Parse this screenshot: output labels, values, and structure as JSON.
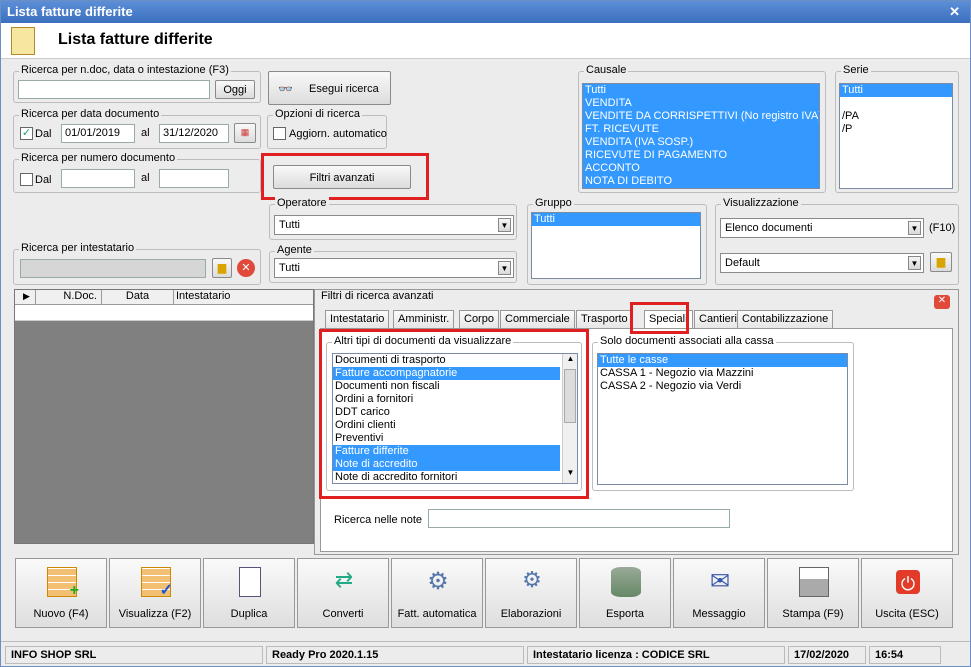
{
  "window": {
    "title": "Lista fatture differite",
    "close": "✕"
  },
  "header": {
    "title": "Lista fatture differite"
  },
  "search_ndoc": {
    "legend": "Ricerca per n.doc, data o intestazione (F3)",
    "value": "",
    "ok": "Oggi"
  },
  "execute": {
    "label": "Esegui ricerca"
  },
  "data_doc": {
    "legend": "Ricerca per data documento",
    "dal_label": "Dal",
    "dal_checked": "✓",
    "from": "01/01/2019",
    "al_label": "al",
    "to": "31/12/2020"
  },
  "opzioni": {
    "legend": "Opzioni di ricerca",
    "auto_label": "Aggiorn. automatico"
  },
  "num_doc": {
    "legend": "Ricerca per numero documento",
    "dal_label": "Dal",
    "al_label": "al"
  },
  "filtri_btn": {
    "label": "Filtri avanzati"
  },
  "operatore": {
    "legend": "Operatore",
    "value": "Tutti"
  },
  "agente": {
    "legend": "Agente",
    "value": "Tutti"
  },
  "intestatario": {
    "legend": "Ricerca per intestatario"
  },
  "causale": {
    "legend": "Causale",
    "items": [
      "Tutti",
      "VENDITA",
      "VENDITE DA CORRISPETTIVI (No registro IVA)",
      "FT. RICEVUTE",
      "VENDITA (IVA SOSP.)",
      "RICEVUTE DI PAGAMENTO",
      "ACCONTO",
      "NOTA DI DEBITO"
    ]
  },
  "serie": {
    "legend": "Serie",
    "items": [
      "Tutti",
      "",
      "/PA",
      "/P"
    ]
  },
  "gruppo": {
    "legend": "Gruppo",
    "items": [
      "Tutti"
    ]
  },
  "visualizzazione": {
    "legend": "Visualizzazione",
    "value1": "Elenco documenti",
    "f10": "(F10)",
    "value2": "Default"
  },
  "grid": {
    "columns": [
      "N.Doc.",
      "Data",
      "Intestatario"
    ]
  },
  "advanced": {
    "title": "Filtri di ricerca avanzati",
    "tabs": [
      "Intestatario",
      "Amministr.",
      "Corpo",
      "Commerciale",
      "Trasporto",
      "Speciali",
      "Cantieri",
      "Contabilizzazione"
    ],
    "altri": {
      "legend": "Altri tipi di documenti da visualizzare",
      "items": [
        "Documenti di trasporto",
        "Fatture accompagnatorie",
        "Documenti non fiscali",
        "Ordini a fornitori",
        "DDT carico",
        "Ordini clienti",
        "Preventivi",
        "Fatture differite",
        "Note di accredito",
        "Note di accredito fornitori"
      ]
    },
    "cassa": {
      "legend": "Solo documenti associati alla cassa",
      "items": [
        "Tutte le casse",
        "CASSA 1 - Negozio via Mazzini",
        "CASSA 2 - Negozio via Verdi"
      ]
    },
    "note_label": "Ricerca nelle note"
  },
  "buttons": [
    {
      "label": "Nuovo (F4)",
      "icon": "grid-add-icon"
    },
    {
      "label": "Visualizza (F2)",
      "icon": "grid-check-icon"
    },
    {
      "label": "Duplica",
      "icon": "copy-icon"
    },
    {
      "label": "Converti",
      "icon": "convert-icon"
    },
    {
      "label": "Fatt. automatica",
      "icon": "gear-icon"
    },
    {
      "label": "Elaborazioni",
      "icon": "process-icon"
    },
    {
      "label": "Esporta",
      "icon": "database-export-icon"
    },
    {
      "label": "Messaggio",
      "icon": "mail-icon"
    },
    {
      "label": "Stampa (F9)",
      "icon": "printer-icon"
    },
    {
      "label": "Uscita (ESC)",
      "icon": "power-icon"
    }
  ],
  "status": {
    "company": "INFO SHOP SRL",
    "version": "Ready Pro 2020.1.15",
    "license": "Intestatario licenza : CODICE SRL",
    "date": "17/02/2020",
    "time": "16:54"
  }
}
